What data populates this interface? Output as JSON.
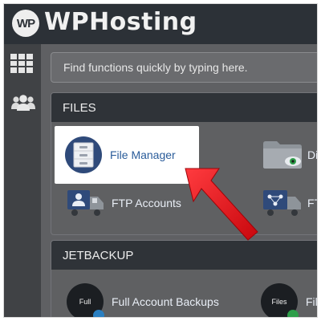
{
  "brand": {
    "logo_text": "WP",
    "name": "WPHosting"
  },
  "search": {
    "placeholder": "Find functions quickly by typing here."
  },
  "sidebar": {
    "items": [
      {
        "icon": "grid-icon"
      },
      {
        "icon": "users-icon"
      }
    ]
  },
  "sections": {
    "files": {
      "title": "FILES",
      "items": [
        {
          "label": "File Manager",
          "icon": "file-cabinet-icon"
        },
        {
          "label": "Di",
          "icon": "folder-eye-icon"
        },
        {
          "label": "FTP Accounts",
          "icon": "ftp-truck-icon"
        },
        {
          "label": "FT",
          "icon": "ftp-network-icon"
        }
      ]
    },
    "jetbackup": {
      "title": "JETBACKUP",
      "items": [
        {
          "label": "Full Account Backups",
          "icon_text": "Full"
        },
        {
          "label": "File",
          "icon_text": "Files"
        }
      ]
    }
  },
  "colors": {
    "accent": "#e0161c",
    "topbar": "#2c3137",
    "link": "#2a5c9a"
  }
}
